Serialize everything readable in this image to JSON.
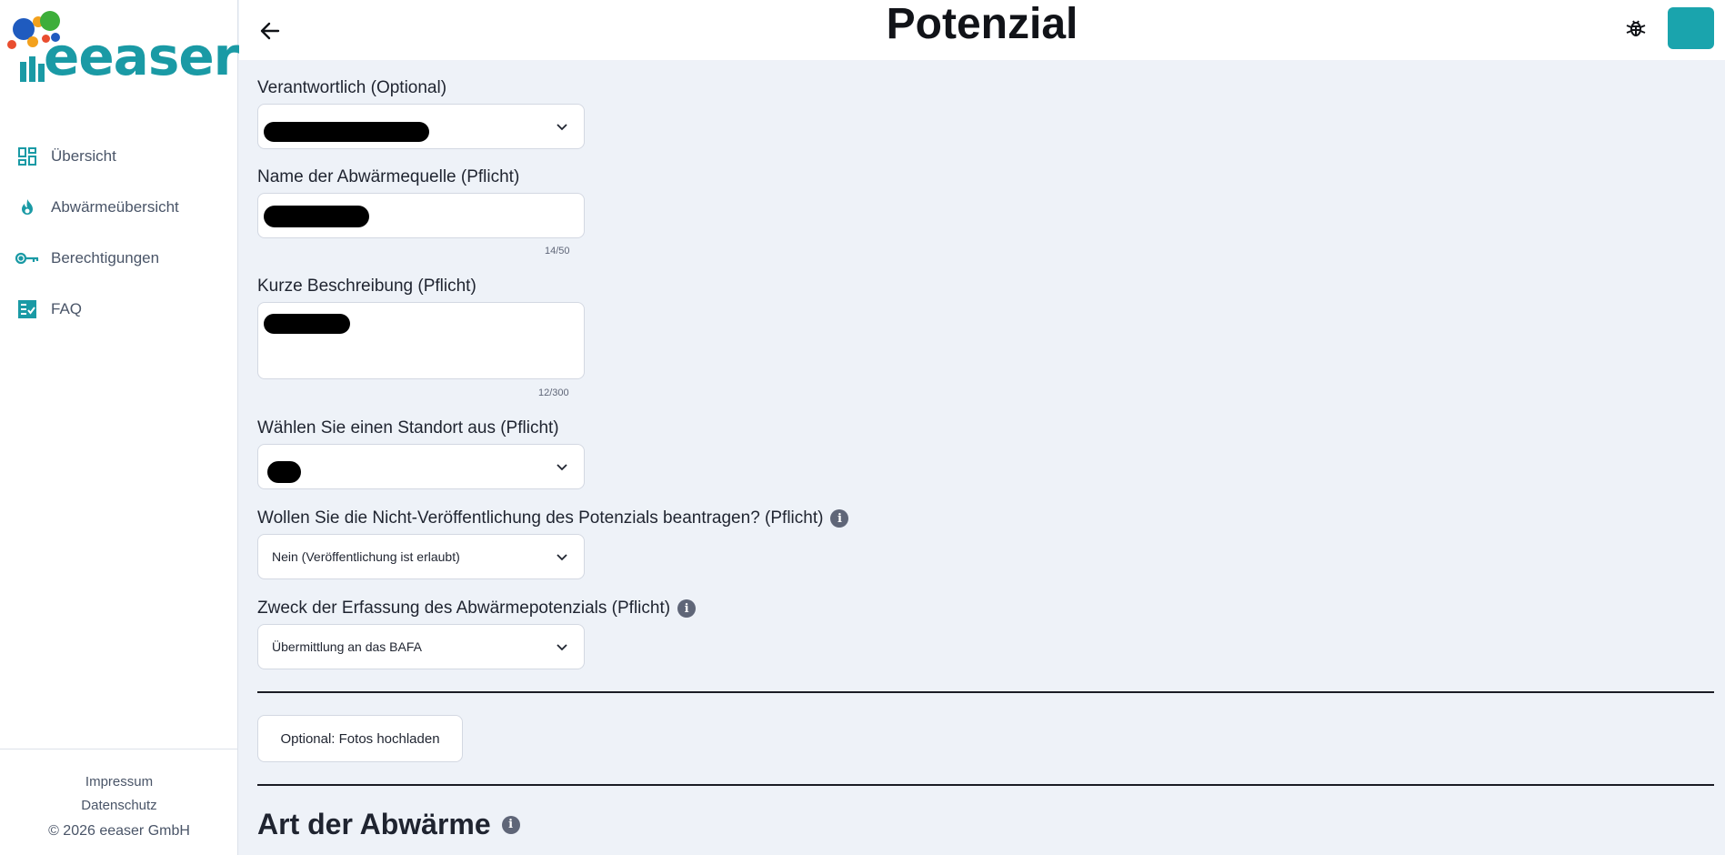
{
  "brand": {
    "name": "eeaser"
  },
  "sidebar": {
    "items": [
      {
        "label": "Übersicht",
        "icon": "dashboard-icon"
      },
      {
        "label": "Abwärmeübersicht",
        "icon": "flame-icon"
      },
      {
        "label": "Berechtigungen",
        "icon": "key-icon"
      },
      {
        "label": "FAQ",
        "icon": "checklist-icon"
      }
    ],
    "footer": {
      "impressum": "Impressum",
      "datenschutz": "Datenschutz",
      "copyright": "© 2026 eeaser GmbH"
    }
  },
  "header": {
    "title": "Potenzial"
  },
  "form": {
    "verantwortlich": {
      "label": "Verantwortlich (Optional)"
    },
    "name": {
      "label": "Name der Abwärmequelle (Pflicht)",
      "counter": "14/50"
    },
    "beschreibung": {
      "label": "Kurze Beschreibung (Pflicht)",
      "counter": "12/300"
    },
    "standort": {
      "label": "Wählen Sie einen Standort aus (Pflicht)"
    },
    "veroeffentlichung": {
      "label": "Wollen Sie die Nicht-Veröffentlichung des Potenzials beantragen? (Pflicht)",
      "value": "Nein (Veröffentlichung ist erlaubt)"
    },
    "zweck": {
      "label": "Zweck der Erfassung des Abwärmepotenzials (Pflicht)",
      "value": "Übermittlung an das BAFA"
    },
    "upload_label": "Optional: Fotos hochladen"
  },
  "section": {
    "title": "Art der Abwärme"
  },
  "colors": {
    "accent": "#1a9aa5",
    "background": "#eef2f8",
    "avatar": "#1aa4ad"
  }
}
